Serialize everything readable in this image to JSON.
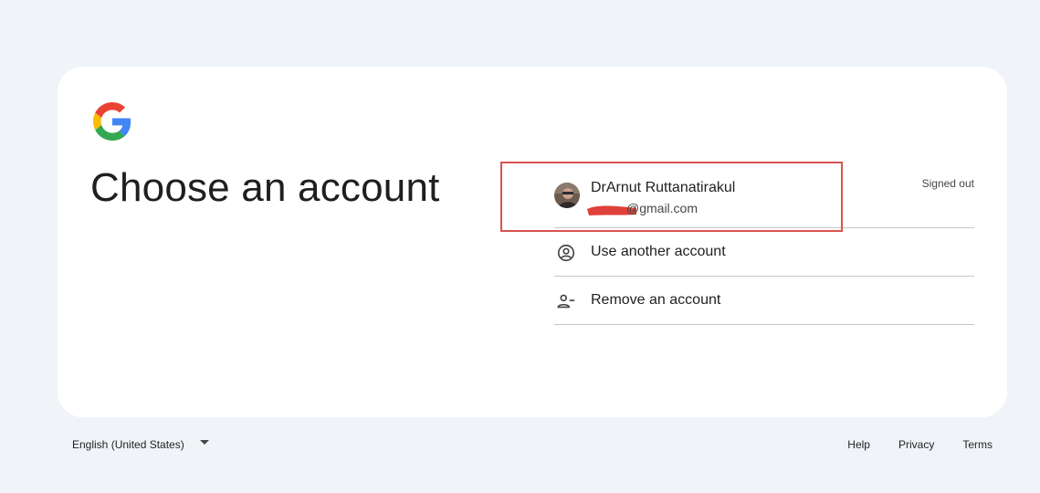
{
  "brand": {
    "logo": "google-g-logo",
    "colors": {
      "blue": "#4285F4",
      "red": "#EA4335",
      "yellow": "#FBBC05",
      "green": "#34A853"
    }
  },
  "main": {
    "title": "Choose an account"
  },
  "accounts": [
    {
      "name": "DrArnut Ruttanatirakul",
      "email": "@gmail.com",
      "status": "Signed out",
      "avatar": "profile-photo"
    }
  ],
  "options": [
    {
      "label": "Use another account",
      "icon": "account-circle-icon"
    },
    {
      "label": "Remove an account",
      "icon": "person-remove-icon"
    }
  ],
  "annotation": {
    "color": "#d9534f",
    "redaction_color": "#e0403a"
  },
  "footer": {
    "language": "English (United States)",
    "links": [
      "Help",
      "Privacy",
      "Terms"
    ]
  }
}
